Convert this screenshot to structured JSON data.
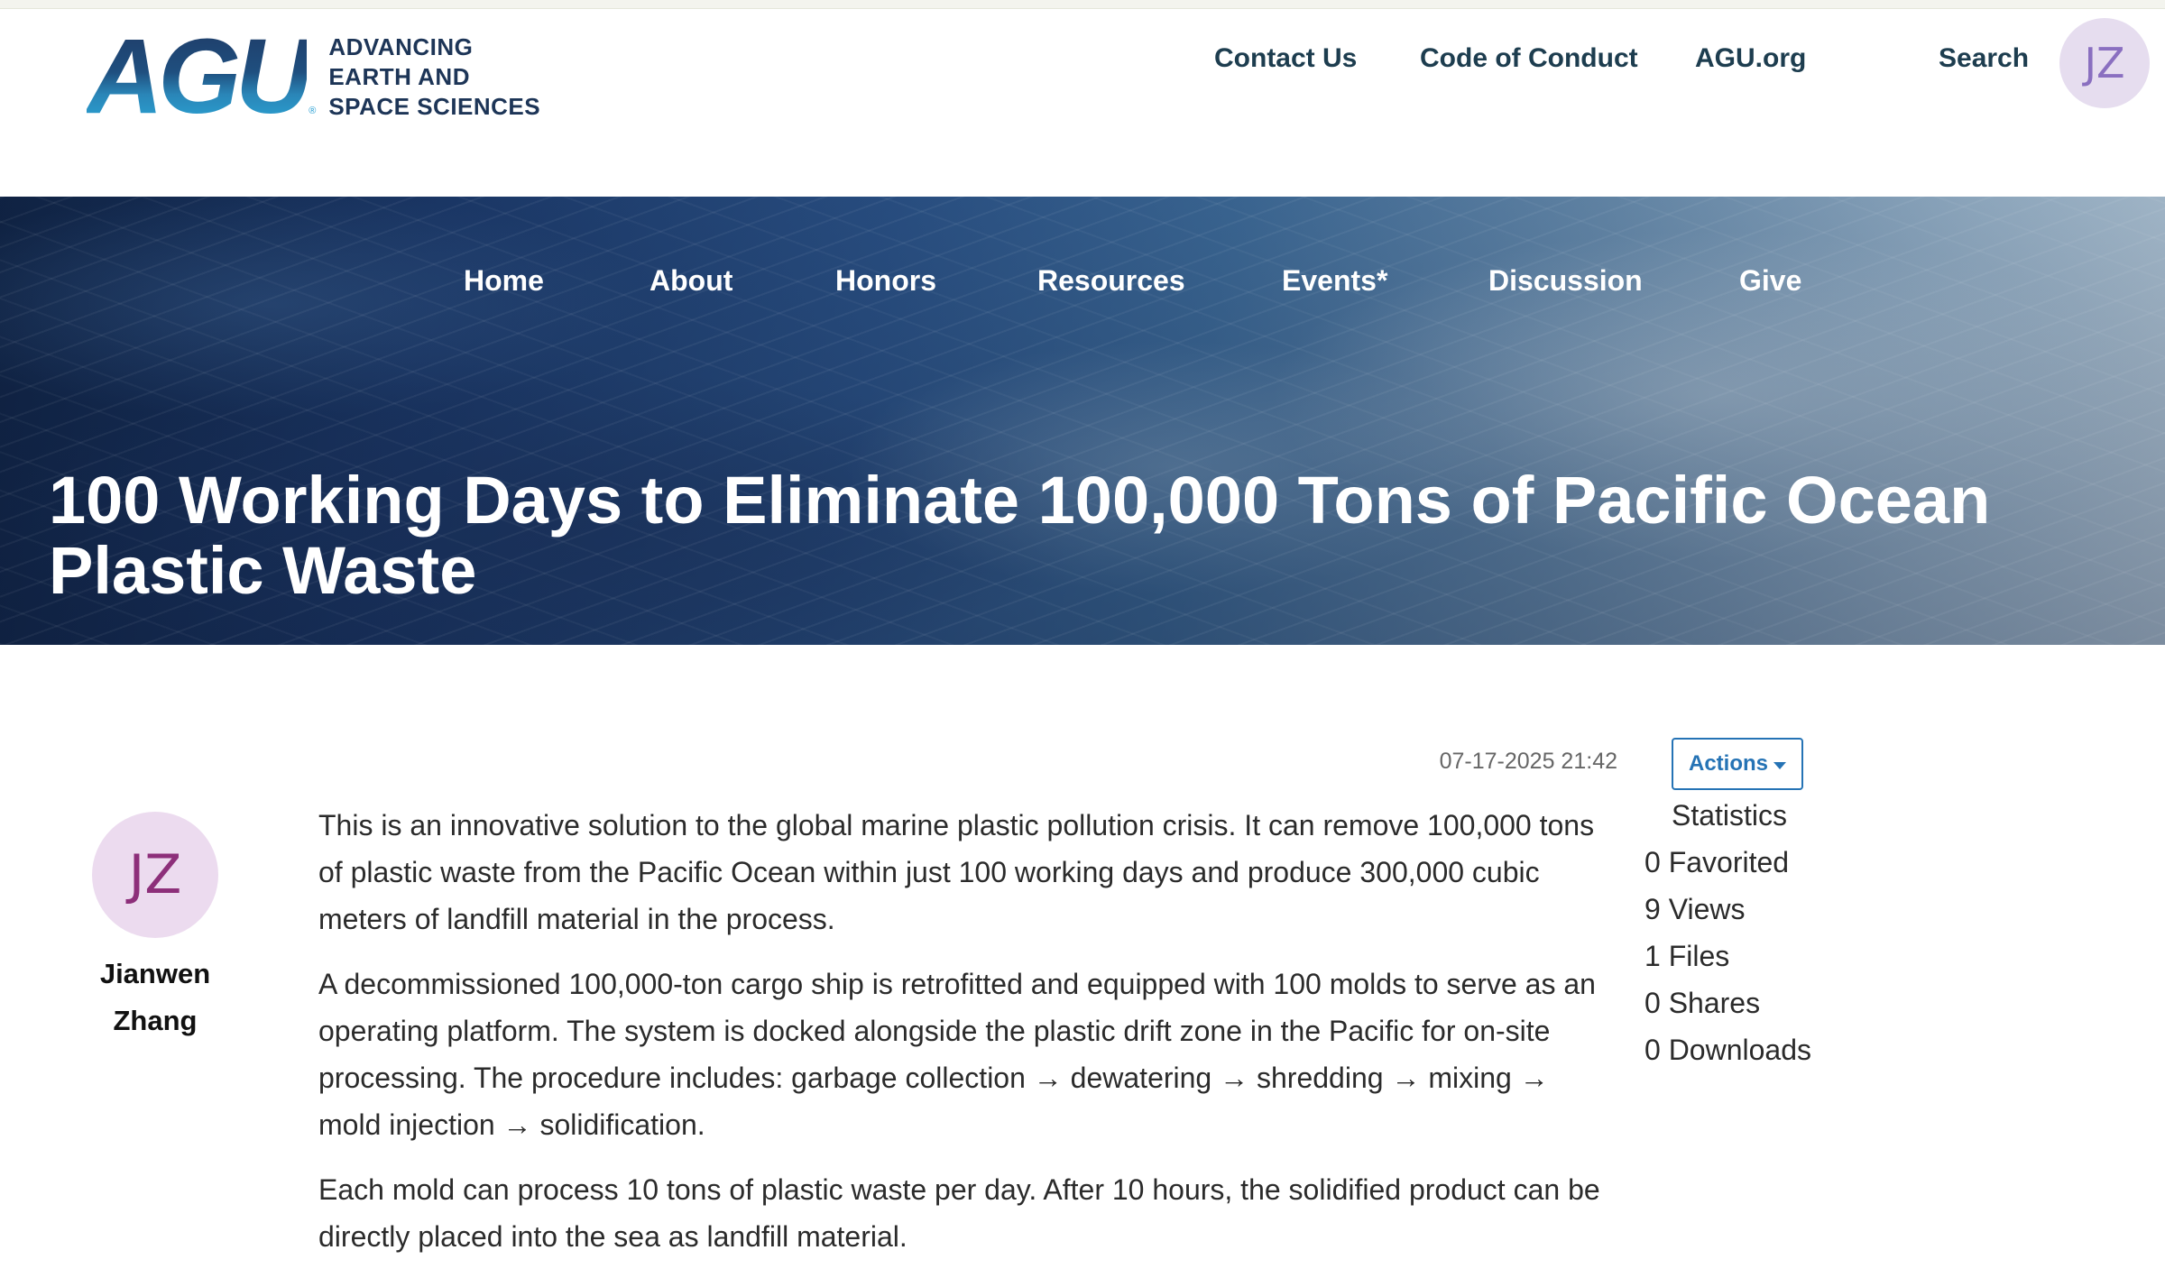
{
  "logo": {
    "letters": "AGU",
    "registered": "®",
    "tagline": [
      "ADVANCING",
      "EARTH AND",
      "SPACE SCIENCES"
    ]
  },
  "utility_nav": {
    "contact": "Contact Us",
    "conduct": "Code of Conduct",
    "agu_org": "AGU.org",
    "search": "Search"
  },
  "user": {
    "initials": "JZ"
  },
  "main_nav": [
    "Home",
    "About",
    "Honors",
    "Resources",
    "Events*",
    "Discussion",
    "Give"
  ],
  "post": {
    "title": "100 Working Days to Eliminate 100,000 Tons of Pacific Ocean Plastic Waste",
    "timestamp": "07-17-2025 21:42",
    "author": {
      "initials": "JZ",
      "name": "Jianwen Zhang"
    },
    "paragraphs": [
      "This is an innovative solution to the global marine plastic pollution crisis. It can remove 100,000 tons of plastic waste from the Pacific Ocean within just 100 working days and produce 300,000 cubic meters of landfill material in the process.",
      "A decommissioned 100,000-ton cargo ship is retrofitted and equipped with 100 molds to serve as an operating platform. The system is docked alongside the plastic drift zone in the Pacific for on-site processing. The procedure includes: garbage collection → dewatering → shredding → mixing → mold injection → solidification.",
      "Each mold can process 10 tons of plastic waste per day. After 10 hours, the solidified product can be directly placed into the sea as landfill material."
    ]
  },
  "sidebar": {
    "actions_label": "Actions",
    "stats_title": "Statistics",
    "stats": [
      "0 Favorited",
      "9 Views",
      "1 Files",
      "0 Shares",
      "0 Downloads"
    ]
  },
  "colors": {
    "brand_navy": "#1d3557",
    "brand_blue": "#2a9fd0",
    "link_blue": "#2573b5"
  }
}
